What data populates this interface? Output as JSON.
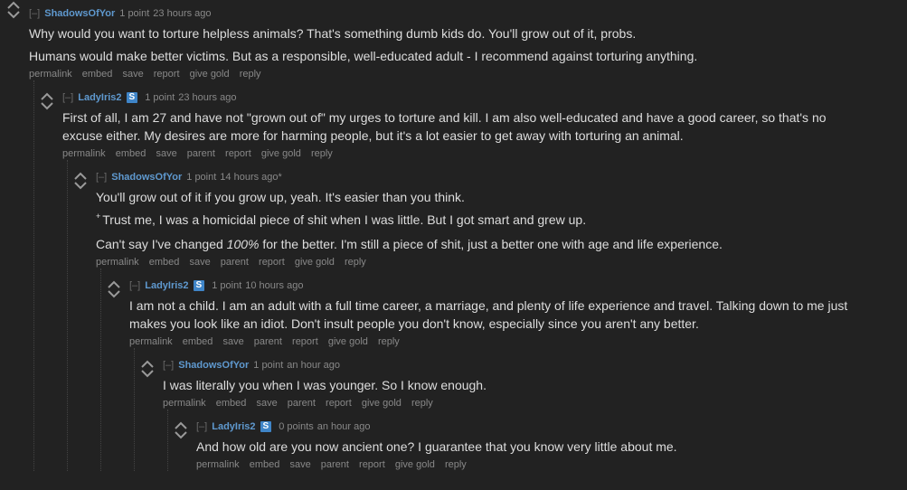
{
  "comments": [
    {
      "expand": "[–]",
      "author": "ShadowsOfYor",
      "flair": "",
      "score": "1 point",
      "time": "23 hours ago",
      "edited": "",
      "paragraphs": [
        "Why would you want to torture helpless animals? That's something dumb kids do. You'll grow out of it, probs.",
        "Humans would make better victims. But as a responsible, well-educated adult - I recommend against torturing anything."
      ],
      "buttons": [
        "permalink",
        "embed",
        "save",
        "report",
        "give gold",
        "reply"
      ]
    },
    {
      "expand": "[–]",
      "author": "LadyIris2",
      "flair": "S",
      "score": "1 point",
      "time": "23 hours ago",
      "edited": "",
      "paragraphs": [
        "First of all, I am 27 and have not \"grown out of\" my urges to torture and kill. I am also well-educated and have a good career, so that's no excuse either. My desires are more for harming people, but it's a lot easier to get away with torturing an animal."
      ],
      "buttons": [
        "permalink",
        "embed",
        "save",
        "parent",
        "report",
        "give gold",
        "reply"
      ]
    },
    {
      "expand": "[–]",
      "author": "ShadowsOfYor",
      "flair": "",
      "score": "1 point",
      "time": "14 hours ago",
      "edited": "*",
      "paragraphs": [
        "You'll grow out of it if you grow up, yeah. It's easier than you think.",
        "Trust me, I was a homicidal piece of shit when I was little. But I got smart and grew up.",
        "Can't say I've changed 100% for the better. I'm still a piece of shit, just a better one with age and life experience."
      ],
      "para_2_sup": "+",
      "para_3_parts": [
        "Can't say I've changed ",
        "100%",
        " for the better. I'm still a piece of shit, just a better one with age and life experience."
      ],
      "buttons": [
        "permalink",
        "embed",
        "save",
        "parent",
        "report",
        "give gold",
        "reply"
      ]
    },
    {
      "expand": "[–]",
      "author": "LadyIris2",
      "flair": "S",
      "score": "1 point",
      "time": "10 hours ago",
      "edited": "",
      "paragraphs": [
        "I am not a child. I am an adult with a full time career, a marriage, and plenty of life experience and travel. Talking down to me just makes you look like an idiot. Don't insult people you don't know, especially since you aren't any better."
      ],
      "buttons": [
        "permalink",
        "embed",
        "save",
        "parent",
        "report",
        "give gold",
        "reply"
      ]
    },
    {
      "expand": "[–]",
      "author": "ShadowsOfYor",
      "flair": "",
      "score": "1 point",
      "time": "an hour ago",
      "edited": "",
      "paragraphs": [
        "I was literally you when I was younger. So I know enough."
      ],
      "buttons": [
        "permalink",
        "embed",
        "save",
        "parent",
        "report",
        "give gold",
        "reply"
      ]
    },
    {
      "expand": "[–]",
      "author": "LadyIris2",
      "flair": "S",
      "score": "0 points",
      "time": "an hour ago",
      "edited": "",
      "paragraphs": [
        "And how old are you now ancient one? I guarantee that you know very little about me."
      ],
      "buttons": [
        "permalink",
        "embed",
        "save",
        "parent",
        "report",
        "give gold",
        "reply"
      ]
    }
  ],
  "colors": {
    "background": "#222222",
    "text": "#dddddd",
    "muted": "#888888",
    "author": "#5f99cf",
    "flair_bg": "#3f85c8"
  },
  "icons": {
    "upvote": "upvote-arrow-icon",
    "downvote": "downvote-arrow-icon"
  }
}
